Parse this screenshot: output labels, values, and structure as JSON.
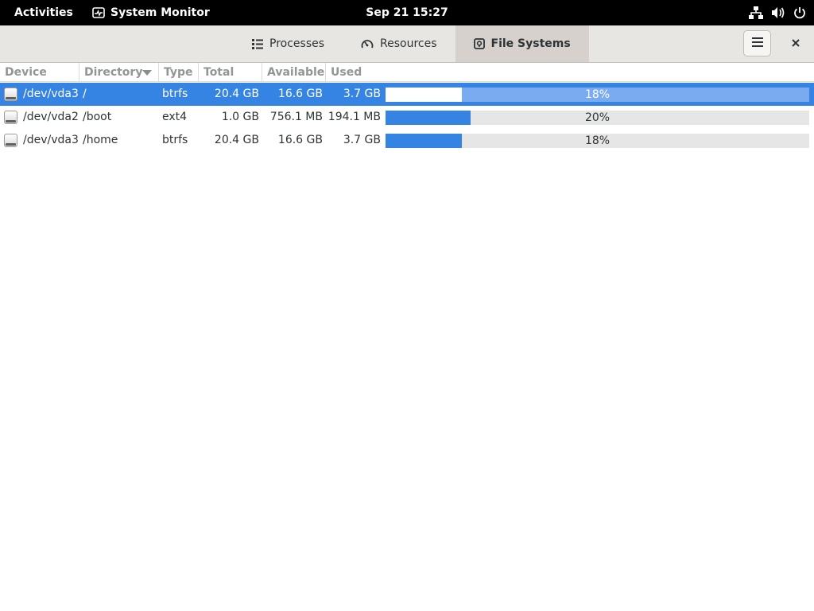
{
  "topbar": {
    "activities": "Activities",
    "app_name": "System Monitor",
    "clock": "Sep 21  15:27"
  },
  "tabs": [
    {
      "label": "Processes",
      "icon": "list-icon"
    },
    {
      "label": "Resources",
      "icon": "gauge-icon"
    },
    {
      "label": "File Systems",
      "icon": "drive-icon",
      "active": true
    }
  ],
  "columns": [
    "Device",
    "Directory",
    "Type",
    "Total",
    "Available",
    "Used"
  ],
  "sort_column": "Directory",
  "rows": [
    {
      "device": "/dev/vda3",
      "directory": "/",
      "type": "btrfs",
      "total": "20.4 GB",
      "available": "16.6 GB",
      "used": "3.7 GB",
      "percent_label": "18%",
      "percent": 18,
      "selected": true
    },
    {
      "device": "/dev/vda2",
      "directory": "/boot",
      "type": "ext4",
      "total": "1.0 GB",
      "available": "756.1 MB",
      "used": "194.1 MB",
      "percent_label": "20%",
      "percent": 20,
      "selected": false
    },
    {
      "device": "/dev/vda3",
      "directory": "/home",
      "type": "btrfs",
      "total": "20.4 GB",
      "available": "16.6 GB",
      "used": "3.7 GB",
      "percent_label": "18%",
      "percent": 18,
      "selected": false
    }
  ],
  "colors": {
    "accent": "#3584e4",
    "selected_bar_track": "#7aaaf0",
    "bar_track": "#e6e6e6"
  }
}
